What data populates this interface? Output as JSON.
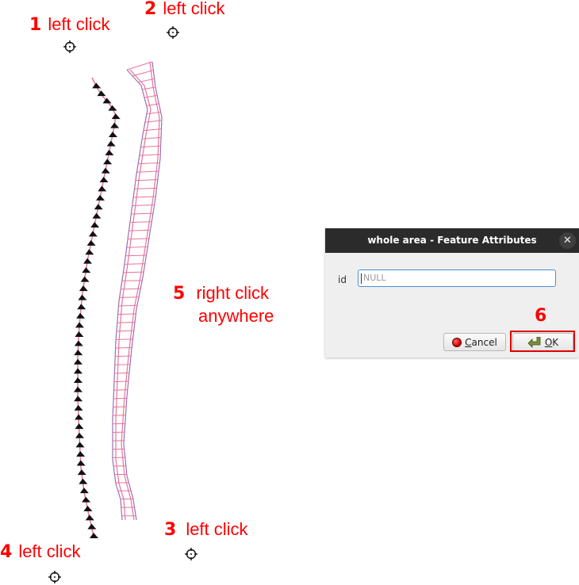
{
  "annotations": [
    {
      "num": "1",
      "text": "left click"
    },
    {
      "num": "2",
      "text": "left click"
    },
    {
      "num": "3",
      "text": "left click"
    },
    {
      "num": "4",
      "text": "left click"
    },
    {
      "num": "5",
      "text": "right click",
      "text2": "anywhere"
    },
    {
      "num": "6"
    }
  ],
  "colors": {
    "annotation": "#ff0000",
    "line_pink": "#e8739a",
    "line_purple": "#9a6fb5",
    "arrow": "#111111"
  },
  "dialog": {
    "title": "whole area - Feature Attributes",
    "close_icon": "close-icon",
    "field_label": "id",
    "field_value": "NULL",
    "cancel_label": "Cancel",
    "cancel_mnemonic": "C",
    "cancel_rest": "ancel",
    "ok_label": "OK",
    "ok_mnemonic": "O",
    "ok_rest": "K"
  }
}
